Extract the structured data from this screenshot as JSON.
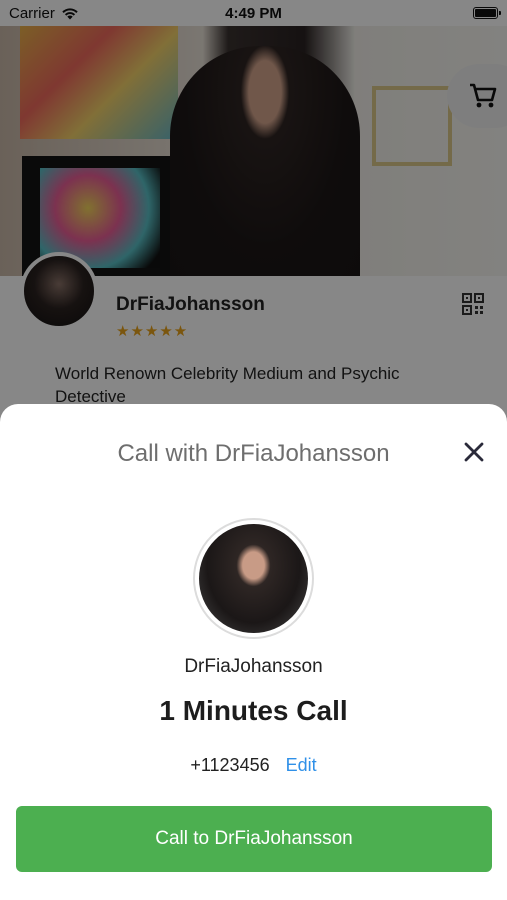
{
  "status_bar": {
    "carrier": "Carrier",
    "time": "4:49 PM"
  },
  "profile": {
    "name": "DrFiaJohansson",
    "rating_stars": "★★★★★",
    "description": "World Renown Celebrity Medium and Psychic Detective"
  },
  "sheet": {
    "title": "Call with DrFiaJohansson",
    "name": "DrFiaJohansson",
    "call_duration": "1 Minutes Call",
    "phone_number": "+1123456",
    "edit_label": "Edit",
    "call_button_label": "Call to DrFiaJohansson"
  },
  "icons": {
    "wifi": "wifi-icon",
    "battery": "battery-icon",
    "cart": "cart-icon",
    "qr": "qr-code-icon",
    "close": "close-icon"
  },
  "colors": {
    "accent_green": "#4caf50",
    "link_blue": "#2f90e8",
    "star_gold": "#e9a21b"
  }
}
